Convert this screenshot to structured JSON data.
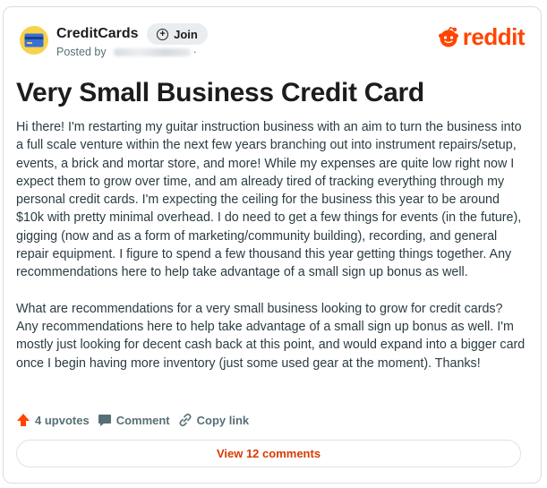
{
  "post": {
    "community": "CreditCards",
    "join_label": "Join",
    "posted_by_label": "Posted by",
    "separator": "·",
    "brand": "reddit",
    "title": "Very Small Business Credit Card",
    "paragraphs": [
      "Hi there! I'm restarting my guitar instruction business with an aim to turn the business into a full scale venture within the next few years branching out into instrument repairs/setup, events, a brick and mortar store, and more! While my expenses are quite low right now I expect them to grow over time, and am already tired of tracking everything through my personal credit cards. I'm expecting the ceiling for the business this year to be around $10k with pretty minimal overhead. I do need to get a few things for events (in the future), gigging (now and as a form of marketing/community building), recording, and general repair equipment. I figure to spend a few thousand this year getting things together. Any recommendations here to help take advantage of a small sign up bonus as well.",
      "What are recommendations for a very small business looking to grow for credit cards? Any recommendations here to help take advantage of a small sign up bonus as well. I'm mostly just looking for decent cash back at this point, and would expand into a bigger card once I begin having more inventory (just some used gear at the moment). Thanks!"
    ],
    "upvotes_label": "4 upvotes",
    "comment_label": "Comment",
    "copy_link_label": "Copy link",
    "view_comments_label": "View 12 comments"
  },
  "colors": {
    "brand_orange": "#ff4500",
    "upvote_orange": "#ff4500",
    "link_red": "#d93a00",
    "community_avatar": "#f7d24a",
    "muted_text": "#576f76"
  },
  "icons": {
    "community_avatar": "credit-card-icon",
    "join": "plus-circle-icon",
    "brand": "reddit-snoo-icon",
    "upvote": "arrow-up-icon",
    "comment": "speech-bubble-icon",
    "copy_link": "link-icon"
  }
}
